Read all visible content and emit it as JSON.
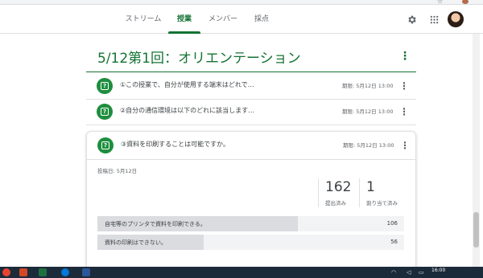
{
  "header": {
    "tabs": [
      {
        "label": "ストリーム",
        "active": false
      },
      {
        "label": "授業",
        "active": true
      },
      {
        "label": "メンバー",
        "active": false
      },
      {
        "label": "採点",
        "active": false
      }
    ],
    "icons": [
      "gear-icon",
      "apps-grid-icon",
      "avatar"
    ]
  },
  "topic": {
    "title": "5/12第1回：オリエンテーション"
  },
  "assignments": [
    {
      "title": "①この授業で、自分が使用する端末はどれで…",
      "due": "期限: 5月12日 13:00",
      "icon": "question-icon"
    },
    {
      "title": "②自分の通信環境は以下のどれに該当します…",
      "due": "期限: 5月12日 13:00",
      "icon": "question-icon"
    }
  ],
  "expanded": {
    "title": "③資料を印刷することは可能ですか。",
    "due": "期限: 5月12日 13:00",
    "posted": "投稿日: 5月12日",
    "stats": [
      {
        "value": "162",
        "label": "提出済み"
      },
      {
        "value": "1",
        "label": "割り当て済み"
      }
    ],
    "options": [
      {
        "label": "自宅等のプリンタで資料を印刷できる。",
        "count": "106",
        "fraction": 0.654
      },
      {
        "label": "資料の印刷はできない。",
        "count": "56",
        "fraction": 0.346
      }
    ]
  },
  "taskbar": {
    "time": "16:00"
  },
  "colors": {
    "accent_green": "#137333",
    "icon_green": "#1e8e3e",
    "taskbar": "#1c2b3a"
  }
}
